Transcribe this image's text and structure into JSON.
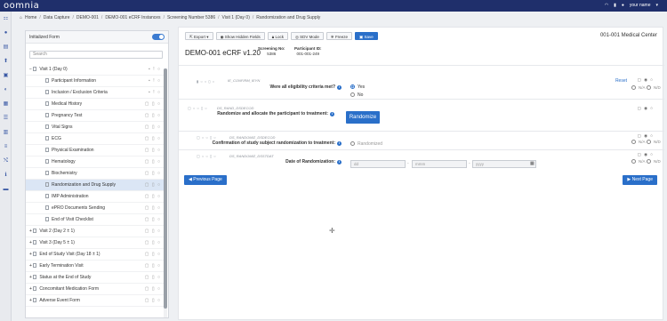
{
  "app": {
    "logo": "oomnia",
    "user": "your name"
  },
  "breadcrumb": [
    "Home",
    "Data Capture",
    "DEMO-001",
    "DEMO-001 eCRF Instances",
    "Screening Number 5386",
    "Visit 1 (Day 0)",
    "Randomization and Drug Supply"
  ],
  "tree": {
    "header_label": "Initialized Form",
    "search_placeholder": "Search",
    "items": [
      {
        "label": "Visit 1 (Day 0)",
        "level": 0,
        "prefix": "−",
        "status": "▪ ! ○"
      },
      {
        "label": "Participant Information",
        "level": 1,
        "status": "▪ ! ○"
      },
      {
        "label": "Inclusion / Exclusion Criteria",
        "level": 1,
        "status": "▪ ! ○"
      },
      {
        "label": "Medical History",
        "level": 1,
        "status": "▢ ▯ ○"
      },
      {
        "label": "Pregnancy Test",
        "level": 1,
        "status": "▢ ▯ ○"
      },
      {
        "label": "Vital Signs",
        "level": 1,
        "status": "▢ ▯ ○"
      },
      {
        "label": "ECG",
        "level": 1,
        "status": "▢ ▯ ○"
      },
      {
        "label": "Physical Examination",
        "level": 1,
        "status": "▢ ▯ ○"
      },
      {
        "label": "Hematology",
        "level": 1,
        "status": "▢ ▯ ○"
      },
      {
        "label": "Biochemistry",
        "level": 1,
        "status": "▢ ▯ ○"
      },
      {
        "label": "Randomization and Drug Supply",
        "level": 1,
        "status": "▢ ▯ ○",
        "selected": true
      },
      {
        "label": "IMP Administration",
        "level": 1,
        "status": "▢ ▯ ○"
      },
      {
        "label": "ePRO Documents Sending",
        "level": 1,
        "status": "▢ ▯ ○"
      },
      {
        "label": "End of Visit Checklist",
        "level": 1,
        "status": "▢ ▯ ○"
      },
      {
        "label": "Visit 2 (Day 2 ± 1)",
        "level": 0,
        "prefix": "+",
        "status": "▢ ▯ ○"
      },
      {
        "label": "Visit 3 (Day 5 ± 1)",
        "level": 0,
        "prefix": "+",
        "status": "▢ ▯ ○"
      },
      {
        "label": "End of Study Visit (Day 18 ± 1)",
        "level": 0,
        "prefix": "+",
        "status": "▢ ▯ ○"
      },
      {
        "label": "Early Termination Visit",
        "level": 0,
        "prefix": "+",
        "status": "▢ ▯ ○"
      },
      {
        "label": "Status at the End of Study",
        "level": 0,
        "prefix": "+",
        "status": "▢ ▯ ○"
      },
      {
        "label": "Concomitant Medication Form",
        "level": 0,
        "prefix": "+",
        "status": "▢ ▯ ○"
      },
      {
        "label": "Adverse Event Form",
        "level": 0,
        "prefix": "+",
        "status": "▢ ▯ ○"
      }
    ]
  },
  "toolbar": {
    "export": "Export",
    "show_hidden": "Show Hidden Fields",
    "lock": "Lock",
    "sdv": "SDV Mode",
    "freeze": "Freeze",
    "save": "Save"
  },
  "site": "001-001 Medical Center",
  "form": {
    "title": "DEMO-001 eCRF v1.20",
    "screening_label": "Screening No:",
    "screening_value": "5386",
    "participant_label": "Participant ID:",
    "participant_value": "001-001-249"
  },
  "fields": {
    "eligibility": {
      "code": "IE_CONFIRM_IEYN",
      "question": "Were all eligibility criteria met?",
      "opt_yes": "Yes",
      "opt_no": "No",
      "reset": "Reset",
      "na": "N/A",
      "nd": "N/D"
    },
    "randomize": {
      "code": "DS_RAND_DSDECOD",
      "question": "Randomize and allocate the participant to treatment:",
      "button": "Randomize"
    },
    "confirm": {
      "code": "DS_RANDOMIZ_DSDECOD",
      "question": "Confirmation of study subject randomization to treatment:",
      "option": "Randomized",
      "na": "N/A",
      "nd": "N/D"
    },
    "date": {
      "code": "DS_RANDOMIZ_DSSTDAT",
      "question": "Date of Randomization:",
      "dd": "dd",
      "mmm": "mmm",
      "yyyy": "yyyy",
      "na": "N/A",
      "nd": "N/D"
    }
  },
  "nav": {
    "prev": "Previous Page",
    "next": "Next Page"
  }
}
